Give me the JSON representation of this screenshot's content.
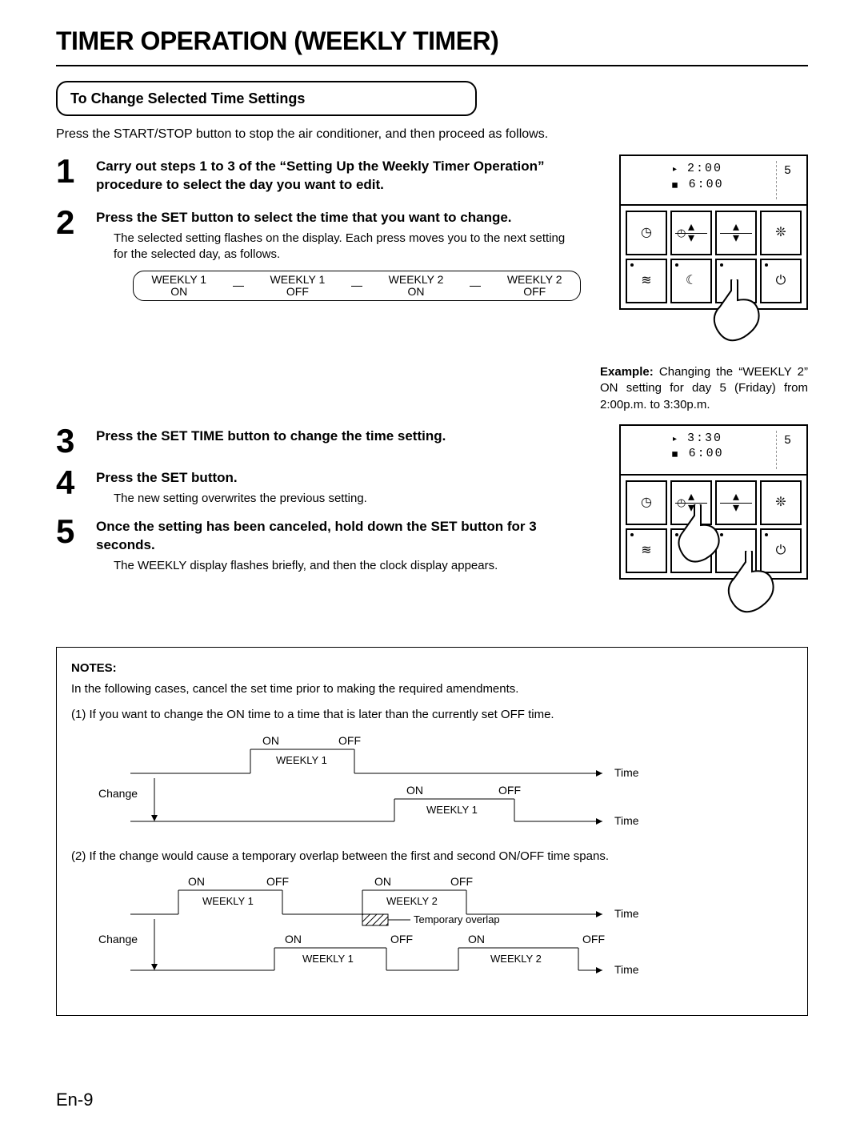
{
  "title": "TIMER OPERATION (WEEKLY TIMER)",
  "subhead": "To Change Selected Time Settings",
  "lead": "Press the START/STOP button to stop the air conditioner, and then proceed as follows.",
  "steps": {
    "s1": {
      "num": "1",
      "title": "Carry out steps 1 to 3 of the “Setting Up the Weekly Timer Operation” procedure to select the day you want to edit."
    },
    "s2": {
      "num": "2",
      "title": "Press the SET button to select the time that you want to change.",
      "desc": "The selected setting flashes on the display. Each press moves you to the next setting for the selected day, as follows."
    },
    "s3": {
      "num": "3",
      "title": "Press the SET TIME button to change the time setting."
    },
    "s4": {
      "num": "4",
      "title": "Press the SET button.",
      "desc": "The new setting overwrites the previous setting."
    },
    "s5": {
      "num": "5",
      "title": "Once the setting has been canceled, hold down the SET button for 3 seconds.",
      "desc": "The WEEKLY display flashes briefly, and then the clock display appears."
    }
  },
  "cycle": [
    {
      "a": "WEEKLY 1",
      "b": "ON"
    },
    {
      "a": "WEEKLY 1",
      "b": "OFF"
    },
    {
      "a": "WEEKLY 2",
      "b": "ON"
    },
    {
      "a": "WEEKLY 2",
      "b": "OFF"
    }
  ],
  "panel1": {
    "line1": "2:00",
    "line2": "6:00",
    "day": "5"
  },
  "panel2": {
    "line1": "3:30",
    "line2": "6:00",
    "day": "5"
  },
  "example": {
    "label": "Example:",
    "text": " Changing the “WEEKLY 2” ON setting for day 5 (Friday) from 2:00p.m. to 3:30p.m."
  },
  "notes": {
    "title": "NOTES:",
    "intro": "In the following cases, cancel the set time prior to making the required amendments.",
    "item1": "(1) If you want to change the ON time to a time that is later than the currently set OFF time.",
    "item2": "(2) If the change would cause a temporary overlap between the first and second ON/OFF time spans.",
    "labels": {
      "on": "ON",
      "off": "OFF",
      "time": "Time",
      "change": "Change",
      "weekly1": "WEEKLY 1",
      "weekly2": "WEEKLY 2",
      "overlap": "Temporary overlap"
    }
  },
  "pagenum": "En-9"
}
